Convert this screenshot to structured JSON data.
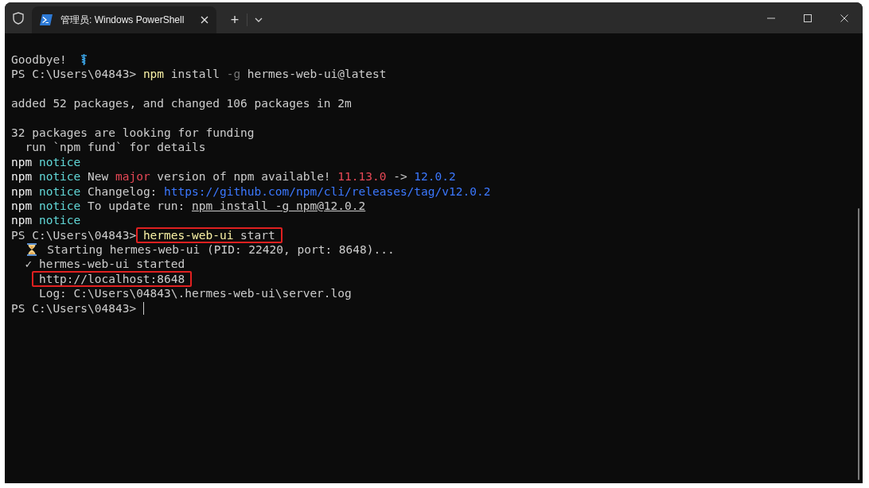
{
  "window": {
    "tab_title": "管理员: Windows PowerShell",
    "new_tab": "+"
  },
  "terminal": {
    "lines": [
      {
        "segments": [
          {
            "kind": "text",
            "text": "Goodbye!  "
          },
          {
            "kind": "farewell"
          }
        ]
      },
      {
        "segments": [
          {
            "kind": "text",
            "text": "PS C:\\Users\\04843> "
          },
          {
            "kind": "command",
            "text": "npm"
          },
          {
            "kind": "text",
            "text": " install "
          },
          {
            "kind": "flag",
            "text": "-g"
          },
          {
            "kind": "text",
            "text": " hermes-web-ui@latest"
          }
        ]
      },
      {
        "segments": [
          {
            "kind": "blank"
          }
        ]
      },
      {
        "segments": [
          {
            "kind": "text",
            "text": "added 52 packages, and changed 106 packages in 2m"
          }
        ]
      },
      {
        "segments": [
          {
            "kind": "blank"
          }
        ]
      },
      {
        "segments": [
          {
            "kind": "text",
            "text": "32 packages are looking for funding"
          }
        ]
      },
      {
        "segments": [
          {
            "kind": "text",
            "text": "  run `npm fund` for details"
          }
        ]
      },
      {
        "segments": [
          {
            "kind": "label",
            "text": "npm "
          },
          {
            "kind": "notice",
            "text": "notice"
          }
        ]
      },
      {
        "segments": [
          {
            "kind": "label",
            "text": "npm "
          },
          {
            "kind": "notice",
            "text": "notice"
          },
          {
            "kind": "text",
            "text": " New "
          },
          {
            "kind": "warning",
            "text": "major"
          },
          {
            "kind": "text",
            "text": " version of npm available! "
          },
          {
            "kind": "warning",
            "text": "11.13.0"
          },
          {
            "kind": "text",
            "text": " -> "
          },
          {
            "kind": "info",
            "text": "12.0.2"
          }
        ]
      },
      {
        "segments": [
          {
            "kind": "label",
            "text": "npm "
          },
          {
            "kind": "notice",
            "text": "notice"
          },
          {
            "kind": "text",
            "text": " Changelog: "
          },
          {
            "kind": "info",
            "text": "https://github.com/npm/cli/releases/tag/v12.0.2"
          }
        ]
      },
      {
        "segments": [
          {
            "kind": "label",
            "text": "npm "
          },
          {
            "kind": "notice",
            "text": "notice"
          },
          {
            "kind": "text",
            "text": " To update run: "
          },
          {
            "kind": "underlined",
            "text": "npm install -g npm@12.0.2"
          }
        ]
      },
      {
        "segments": [
          {
            "kind": "label",
            "text": "npm "
          },
          {
            "kind": "notice",
            "text": "notice"
          }
        ]
      },
      {
        "segments": [
          {
            "kind": "text",
            "text": "PS C:\\Users\\04843> "
          },
          {
            "kind": "command",
            "text": "hermes-web-ui",
            "boxed": true
          },
          {
            "kind": "text",
            "text": " start",
            "boxed": true
          }
        ]
      },
      {
        "segments": [
          {
            "kind": "waiting"
          },
          {
            "kind": "text",
            "text": " Starting hermes-web-ui (PID: 22420, port: 8648)..."
          }
        ]
      },
      {
        "segments": [
          {
            "kind": "text",
            "text": "  ✓ hermes-web-ui started"
          }
        ]
      },
      {
        "segments": [
          {
            "kind": "text",
            "text": "    http://localhost:8648",
            "boxed": true
          }
        ]
      },
      {
        "segments": [
          {
            "kind": "text",
            "text": "    Log: C:\\Users\\04843\\.hermes-web-ui\\server.log"
          }
        ]
      },
      {
        "segments": [
          {
            "kind": "text",
            "text": "PS C:\\Users\\04843> "
          },
          {
            "kind": "cursor"
          }
        ]
      }
    ]
  }
}
